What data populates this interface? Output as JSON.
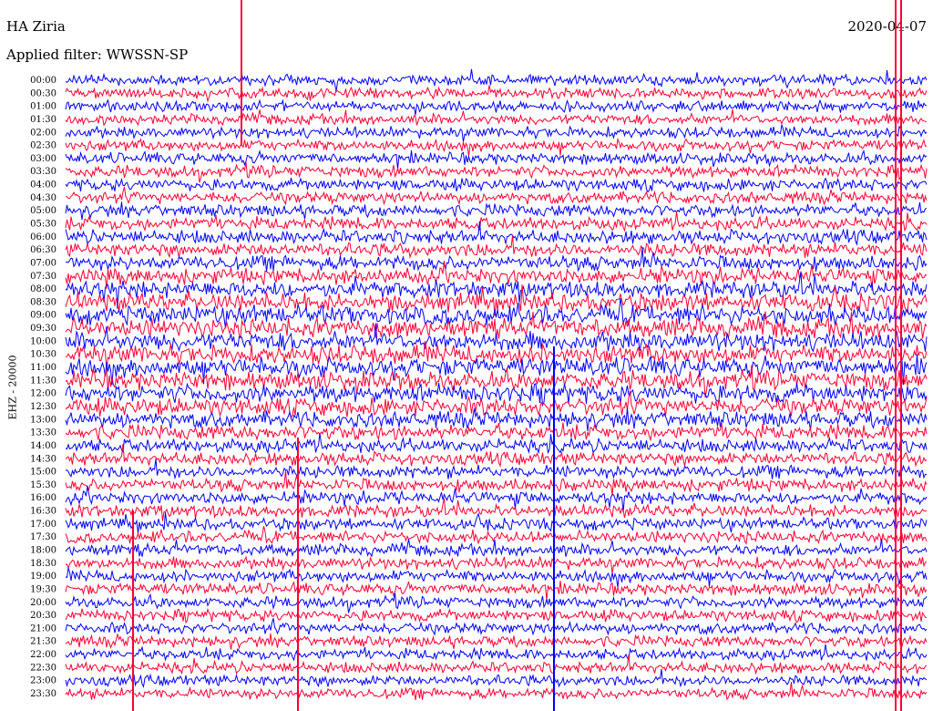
{
  "header": {
    "station": "HA Ziria",
    "filter_label": "Applied filter: WWSSN-SP",
    "date": "2020-04-07"
  },
  "chart_data": {
    "type": "line",
    "title": "HA Ziria",
    "subtitle": "Applied filter: WWSSN-SP",
    "date": "2020-04-07",
    "ylabel": "EHZ - 20000",
    "xlabel": "",
    "row_times": [
      "00:00",
      "00:30",
      "01:00",
      "01:30",
      "02:00",
      "02:30",
      "03:00",
      "03:30",
      "04:00",
      "04:30",
      "05:00",
      "05:30",
      "06:00",
      "06:30",
      "07:00",
      "07:30",
      "08:00",
      "08:30",
      "09:00",
      "09:30",
      "10:00",
      "10:30",
      "11:00",
      "11:30",
      "12:00",
      "12:30",
      "13:00",
      "13:30",
      "14:00",
      "14:30",
      "15:00",
      "15:30",
      "16:00",
      "16:30",
      "17:00",
      "17:30",
      "18:00",
      "18:30",
      "19:00",
      "19:30",
      "20:00",
      "20:30",
      "21:00",
      "21:30",
      "22:00",
      "22:30",
      "23:00",
      "23:30"
    ],
    "row_colors": [
      "#0000ff",
      "#ff0033"
    ],
    "grid": false,
    "legend": "none",
    "activity": [
      0.35,
      0.35,
      0.35,
      0.35,
      0.38,
      0.4,
      0.42,
      0.45,
      0.45,
      0.45,
      0.5,
      0.55,
      0.6,
      0.6,
      0.65,
      0.75,
      0.85,
      0.95,
      1.0,
      1.0,
      1.0,
      1.0,
      1.0,
      1.0,
      0.95,
      0.9,
      0.8,
      0.7,
      0.6,
      0.55,
      0.5,
      0.5,
      0.5,
      0.5,
      0.45,
      0.45,
      0.45,
      0.45,
      0.45,
      0.45,
      0.42,
      0.4,
      0.4,
      0.4,
      0.4,
      0.4,
      0.38,
      0.35
    ]
  }
}
